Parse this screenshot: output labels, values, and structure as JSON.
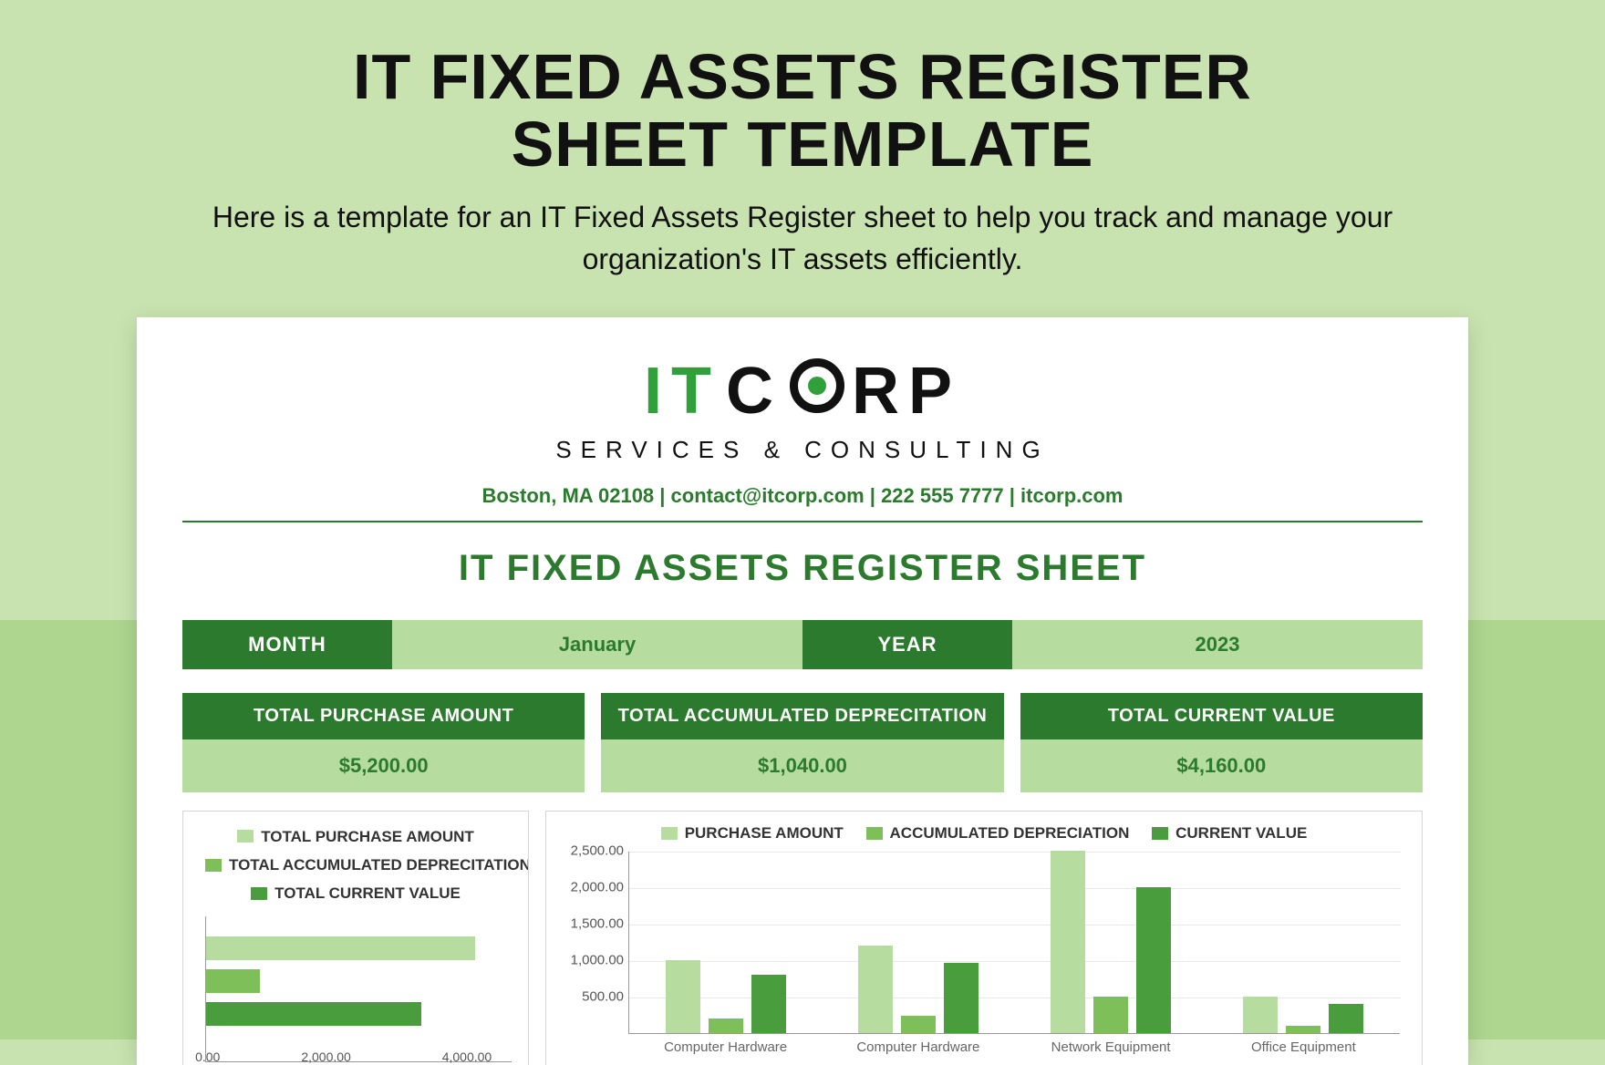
{
  "header": {
    "title_line1": "IT FIXED ASSETS REGISTER",
    "title_line2": "SHEET TEMPLATE",
    "subtitle": "Here is a template for an IT Fixed Assets Register sheet to help you track and manage your organization's IT assets efficiently."
  },
  "logo": {
    "it": "IT",
    "c": "C",
    "rp": "RP",
    "sub": "SERVICES & CONSULTING"
  },
  "contact": "Boston, MA 02108  |  contact@itcorp.com  |  222 555 7777  |  itcorp.com",
  "sheet_title": "IT FIXED ASSETS REGISTER SHEET",
  "period": {
    "month_label": "MONTH",
    "month_value": "January",
    "year_label": "YEAR",
    "year_value": "2023"
  },
  "totals": [
    {
      "label": "TOTAL PURCHASE AMOUNT",
      "value": "$5,200.00"
    },
    {
      "label": "TOTAL ACCUMULATED DEPRECITATION",
      "value": "$1,040.00"
    },
    {
      "label": "TOTAL CURRENT VALUE",
      "value": "$4,160.00"
    }
  ],
  "legend_left": {
    "s1": "TOTAL PURCHASE AMOUNT",
    "s2": "TOTAL ACCUMULATED DEPRECITATION",
    "s3": "TOTAL CURRENT VALUE"
  },
  "legend_right": {
    "s1": "PURCHASE AMOUNT",
    "s2": "ACCUMULATED DEPRECIATION",
    "s3": "CURRENT VALUE"
  },
  "chart_data": [
    {
      "type": "bar",
      "orientation": "horizontal",
      "title": "",
      "categories": [
        "TOTAL PURCHASE AMOUNT",
        "TOTAL ACCUMULATED DEPRECITATION",
        "TOTAL CURRENT VALUE"
      ],
      "values": [
        5200,
        1040,
        4160
      ],
      "xlim": [
        0,
        6000
      ],
      "xticks": [
        "0.00",
        "2,000.00",
        "4,000.00"
      ]
    },
    {
      "type": "bar",
      "orientation": "vertical",
      "title": "",
      "categories": [
        "Computer Hardware",
        "Computer Hardware",
        "Network Equipment",
        "Office Equipment"
      ],
      "series": [
        {
          "name": "PURCHASE AMOUNT",
          "values": [
            1000,
            1200,
            2500,
            500
          ]
        },
        {
          "name": "ACCUMULATED DEPRECIATION",
          "values": [
            200,
            240,
            500,
            100
          ]
        },
        {
          "name": "CURRENT VALUE",
          "values": [
            800,
            960,
            2000,
            400
          ]
        }
      ],
      "ylim": [
        0,
        2500
      ],
      "yticks": [
        "500.00",
        "1,000.00",
        "1,500.00",
        "2,000.00",
        "2,500.00"
      ]
    }
  ]
}
